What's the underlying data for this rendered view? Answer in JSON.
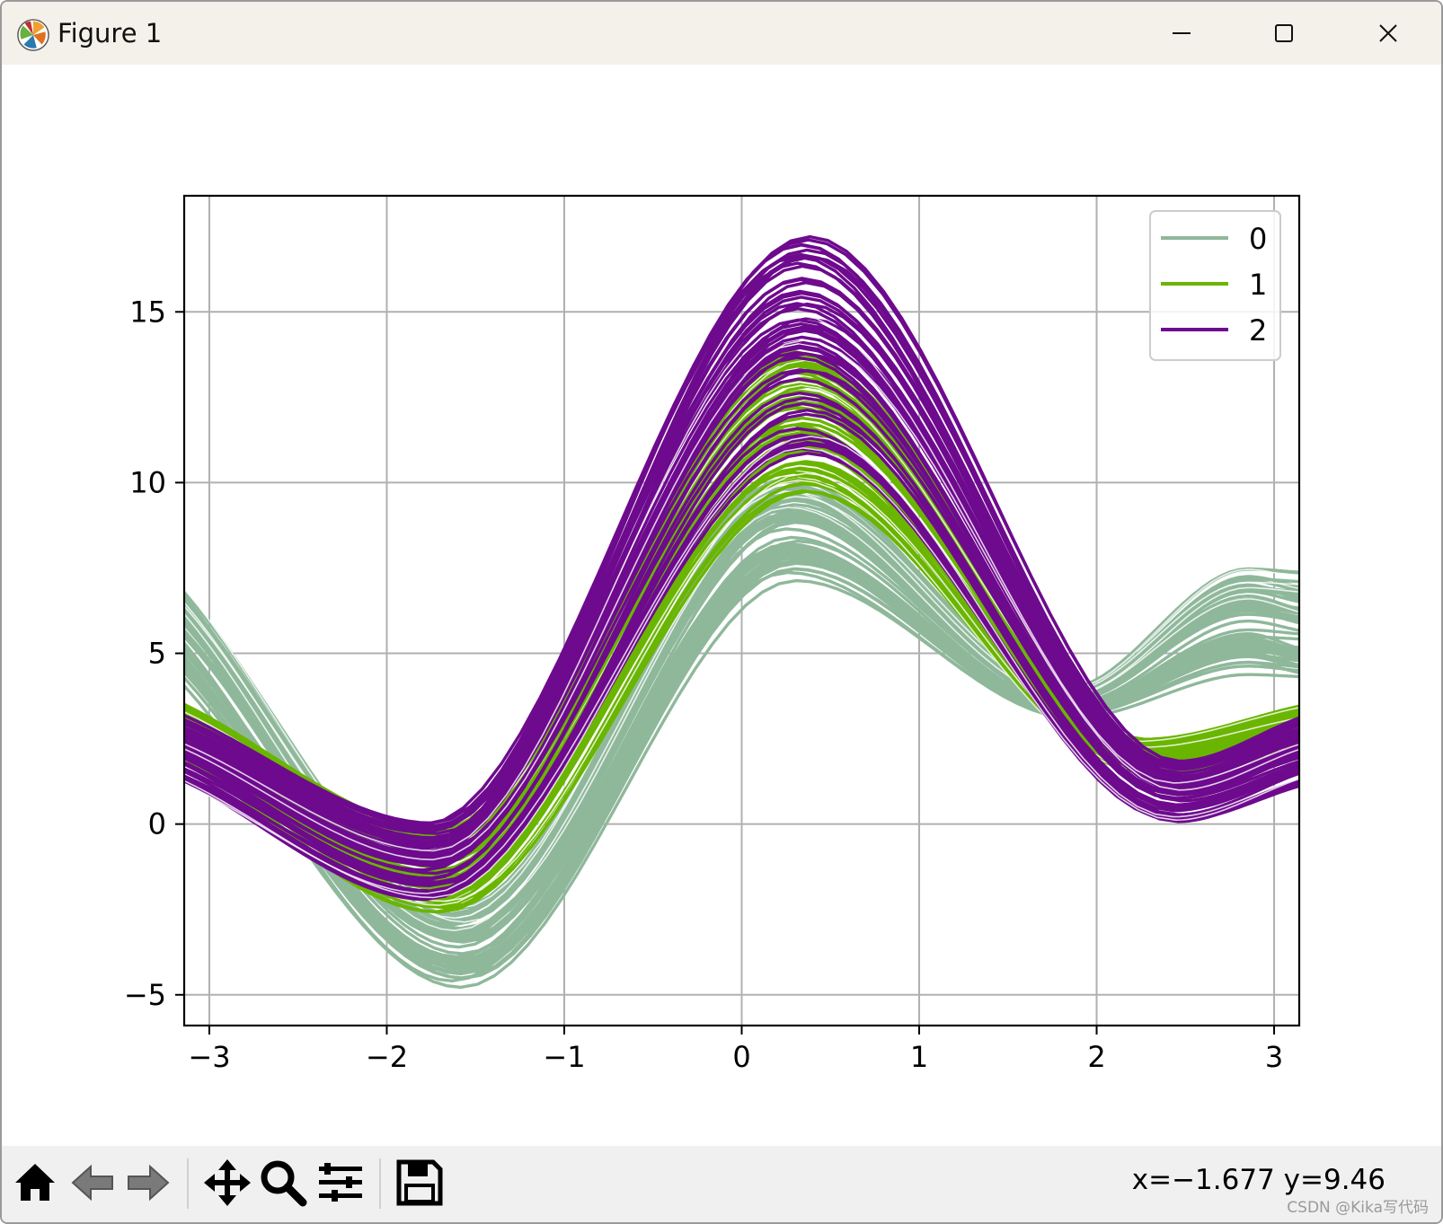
{
  "window": {
    "title": "Figure 1",
    "icon": "matplotlib-logo",
    "controls": [
      "minimize-icon",
      "maximize-icon",
      "close-icon"
    ]
  },
  "toolbar": {
    "buttons": [
      "home-icon",
      "back-icon",
      "forward-icon",
      "pan-icon",
      "zoom-icon",
      "configure-subplots-icon",
      "save-icon"
    ],
    "coords": "x=−1.677 y=9.46",
    "watermark": "CSDN @Kika写代码"
  },
  "chart_data": {
    "type": "line",
    "kind": "andrews-curves",
    "title": "",
    "xlabel": "",
    "ylabel": "",
    "xlim": [
      -3.1416,
      3.1416
    ],
    "ylim": [
      -5.9,
      18.4
    ],
    "xticks": [
      -3,
      -2,
      -1,
      0,
      1,
      2,
      3
    ],
    "xtick_labels": [
      "−3",
      "−2",
      "−1",
      "0",
      "1",
      "2",
      "3"
    ],
    "yticks": [
      -5,
      0,
      5,
      10,
      15
    ],
    "ytick_labels": [
      "−5",
      "0",
      "5",
      "10",
      "15"
    ],
    "grid": true,
    "legend_position": "top-right",
    "series": [
      {
        "name": "0",
        "color": "#8fb89b",
        "curves": 50,
        "start_y_range": [
          4.1,
          6.9
        ],
        "peak_y_range": [
          7.1,
          10.2
        ],
        "peak_x": 0.28,
        "min_y_range": [
          -4.8,
          -2.4
        ],
        "min_x": -1.6,
        "end_y_range": [
          4.1,
          7.3
        ]
      },
      {
        "name": "1",
        "color": "#6ab500",
        "curves": 50,
        "start_y_range": [
          2.0,
          3.5
        ],
        "peak_y_range": [
          9.7,
          13.9
        ],
        "peak_x": 0.33,
        "min_y_range": [
          -2.6,
          -0.1
        ],
        "min_x": -1.7,
        "end_y_range": [
          2.0,
          3.5
        ]
      },
      {
        "name": "2",
        "color": "#6e0a8e",
        "curves": 50,
        "start_y_range": [
          1.1,
          3.1
        ],
        "peak_y_range": [
          10.6,
          17.4
        ],
        "peak_x": 0.35,
        "min_y_range": [
          -2.3,
          0.1
        ],
        "min_x": -1.75,
        "end_y_range": [
          1.1,
          3.1
        ]
      }
    ]
  }
}
